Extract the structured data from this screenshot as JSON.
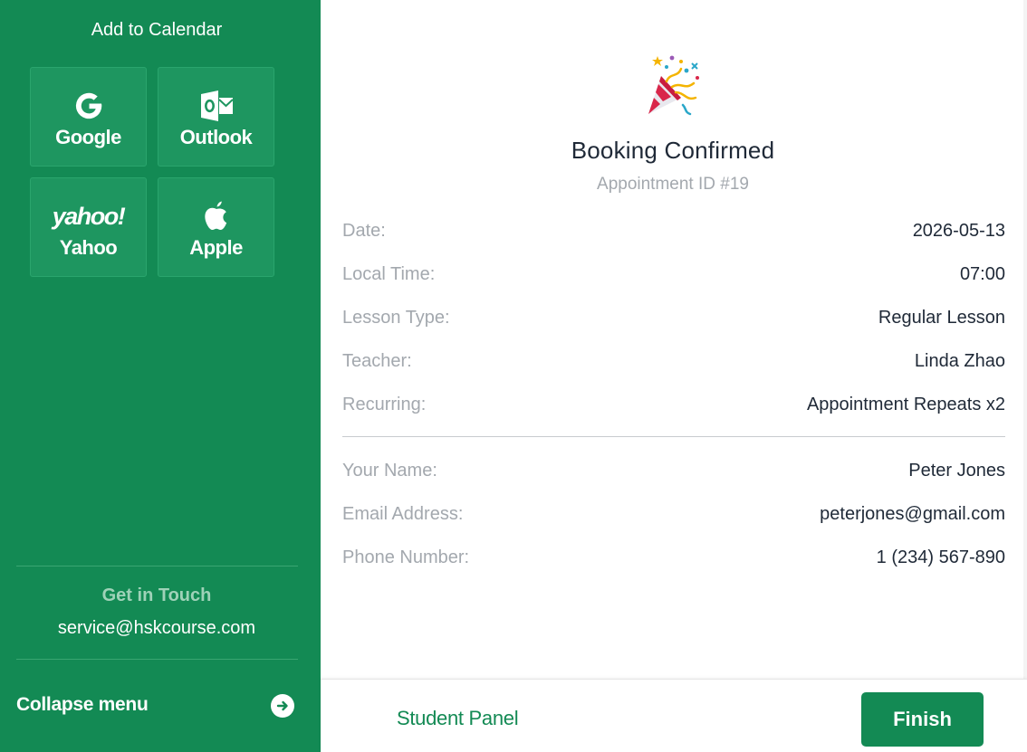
{
  "sidebar": {
    "calendar_title": "Add to Calendar",
    "calendars": [
      {
        "label": "Google",
        "icon": "google-icon"
      },
      {
        "label": "Outlook",
        "icon": "outlook-icon"
      },
      {
        "label": "Yahoo",
        "icon": "yahoo-icon",
        "logo_text": "yahoo!"
      },
      {
        "label": "Apple",
        "icon": "apple-icon"
      }
    ],
    "contact_title": "Get in Touch",
    "contact_email": "service@hskcourse.com",
    "collapse_label": "Collapse menu",
    "accent_color": "#138a54"
  },
  "confirmation": {
    "icon": "party-popper-icon",
    "title": "Booking Confirmed",
    "appointment_id": "Appointment ID #19",
    "details": [
      {
        "label": "Date:",
        "value": "2026-05-13"
      },
      {
        "label": "Local Time:",
        "value": "07:00"
      },
      {
        "label": "Lesson Type:",
        "value": "Regular Lesson"
      },
      {
        "label": "Teacher:",
        "value": "Linda Zhao"
      },
      {
        "label": "Recurring:",
        "value": "Appointment Repeats x2"
      }
    ],
    "contact": [
      {
        "label": "Your Name:",
        "value": "Peter Jones"
      },
      {
        "label": "Email Address:",
        "value": "peterjones@gmail.com"
      },
      {
        "label": "Phone Number:",
        "value": "1 (234) 567-890"
      }
    ]
  },
  "footer": {
    "student_panel_label": "Student Panel",
    "finish_label": "Finish"
  }
}
